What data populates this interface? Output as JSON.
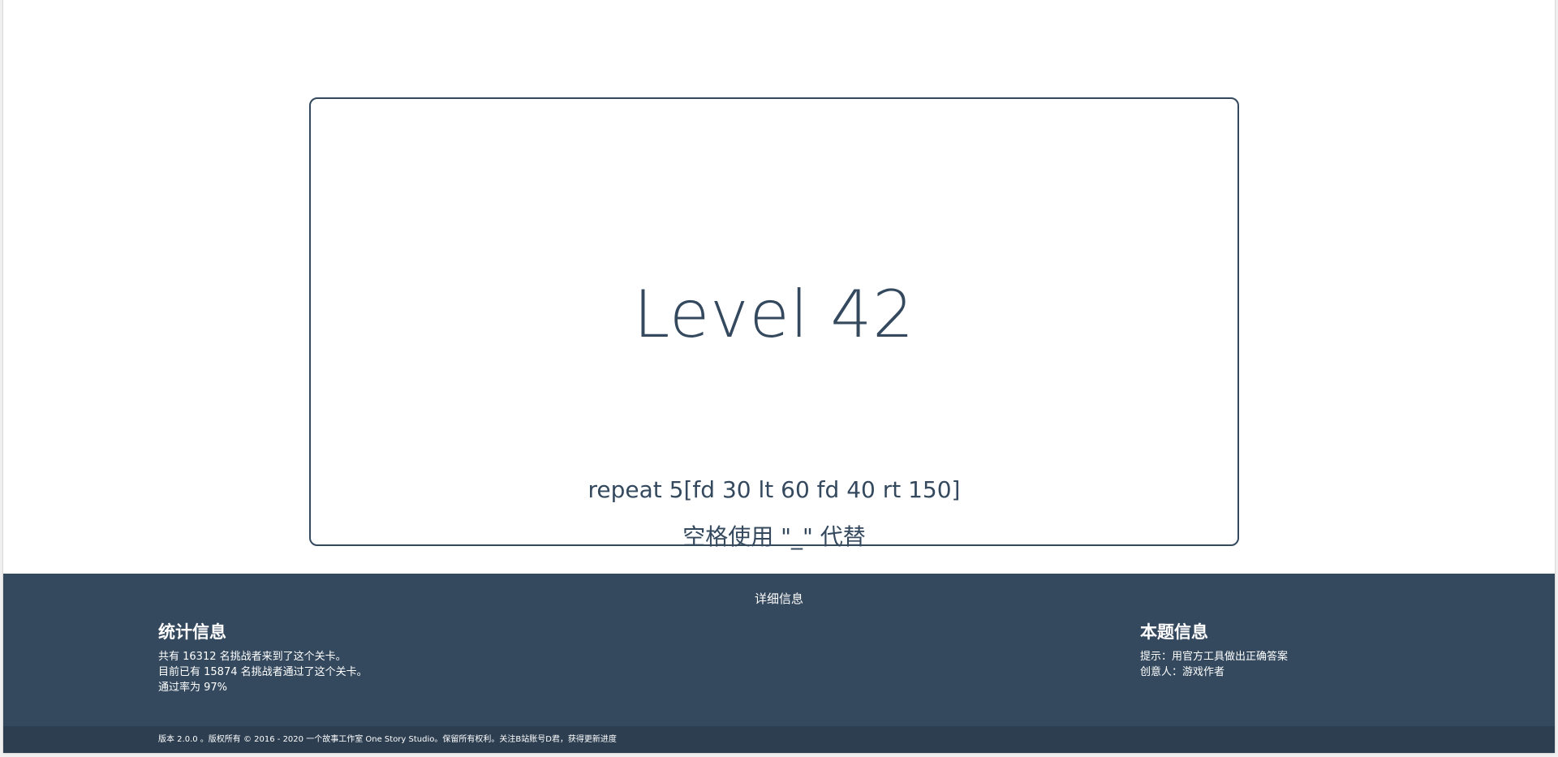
{
  "level": {
    "title": "Level 42",
    "code": "repeat 5[fd 30 lt 60 fd 40 rt 150]",
    "hint": "空格使用 \"_\" 代替"
  },
  "footer": {
    "heading": "详细信息",
    "stats": {
      "title": "统计信息",
      "lines": [
        "共有 16312 名挑战者来到了这个关卡。",
        "目前已有 15874 名挑战者通过了这个关卡。",
        "通过率为 97%"
      ]
    },
    "problem": {
      "title": "本题信息",
      "lines": [
        "提示：用官方工具做出正确答案",
        "创意人：游戏作者"
      ]
    },
    "copyright": "版本 2.0.0 。版权所有 © 2016 - 2020 一个故事工作室 One Story Studio。保留所有权利。关注B站账号D君，获得更新进度"
  },
  "colors": {
    "primary": "#34495e",
    "footer_dark": "#2c3e50",
    "background": "#ffffff"
  }
}
